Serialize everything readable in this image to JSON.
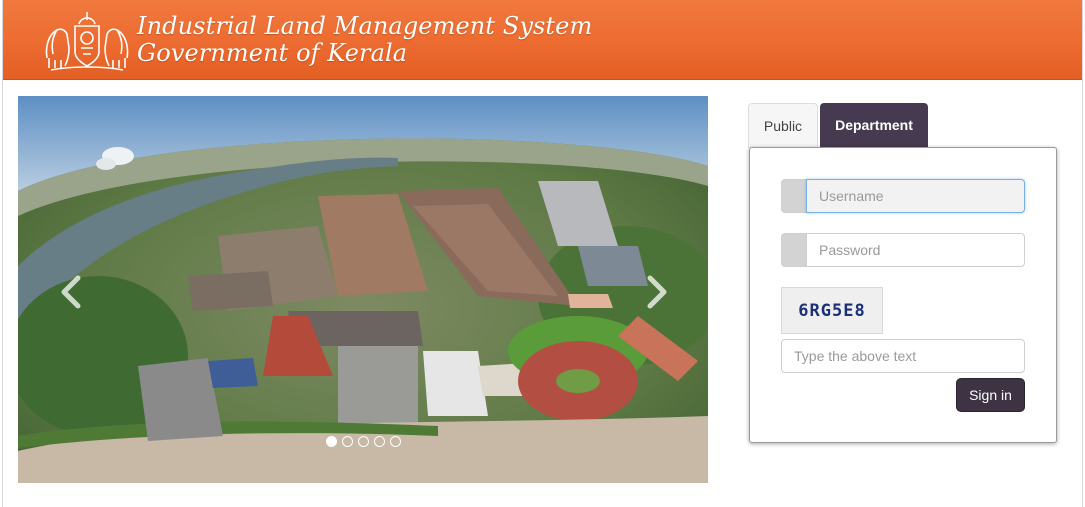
{
  "header": {
    "title_line1": "Industrial Land Management System",
    "title_line2": "Government of Kerala",
    "brand_color": "#ec6b30",
    "emblem_icon": "kerala-emblem-icon"
  },
  "carousel": {
    "slide_count": 5,
    "active_slide": 1,
    "prev_icon": "chevron-left-icon",
    "next_icon": "chevron-right-icon"
  },
  "login": {
    "tabs": [
      {
        "label": "Public",
        "active": false
      },
      {
        "label": "Department",
        "active": true
      }
    ],
    "username": {
      "placeholder": "Username",
      "value": ""
    },
    "password": {
      "placeholder": "Password",
      "value": ""
    },
    "captcha_text": "6RG5E8",
    "captcha_input": {
      "placeholder": "Type the above text",
      "value": ""
    },
    "signin_label": "Sign in",
    "accent_color": "#453a4f"
  }
}
